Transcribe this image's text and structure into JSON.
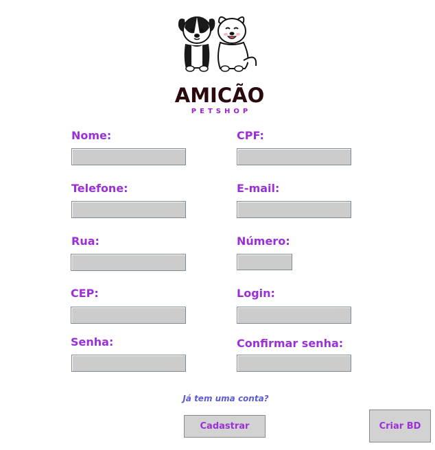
{
  "brand": {
    "name": "AMICÃO",
    "tagline": "PETSHOP"
  },
  "form": {
    "nome": {
      "label": "Nome:",
      "value": ""
    },
    "cpf": {
      "label": "CPF:",
      "value": ""
    },
    "telefone": {
      "label": "Telefone:",
      "value": ""
    },
    "email": {
      "label": "E-mail:",
      "value": ""
    },
    "rua": {
      "label": "Rua:",
      "value": ""
    },
    "numero": {
      "label": "Número:",
      "value": ""
    },
    "cep": {
      "label": "CEP:",
      "value": ""
    },
    "login": {
      "label": "Login:",
      "value": ""
    },
    "senha": {
      "label": "Senha:",
      "value": ""
    },
    "confirmar_senha": {
      "label": "Confirmar senha:",
      "value": ""
    }
  },
  "login_link": "Já tem uma conta?",
  "buttons": {
    "cadastrar": "Cadastrar",
    "criar_bd": "Criar BD"
  },
  "colors": {
    "label": "#9b30d9",
    "field_bg": "#cccccc",
    "link": "#5b5bd6",
    "brand": "#2a0a0f"
  }
}
